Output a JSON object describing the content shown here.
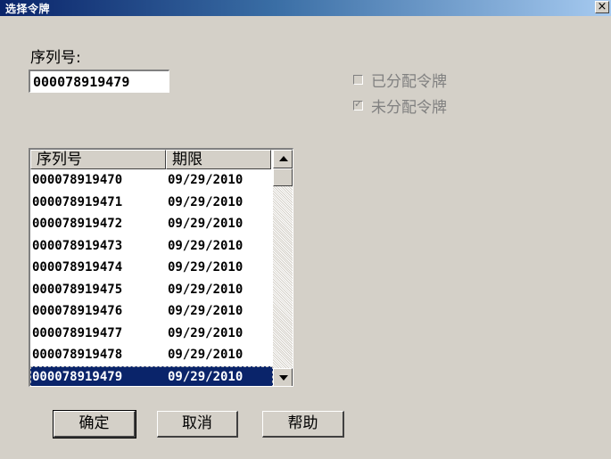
{
  "window": {
    "title": "选择令牌",
    "close_glyph": "×"
  },
  "serial": {
    "label": "序列号:",
    "value": "000078919479"
  },
  "checkboxes": [
    {
      "label": "已分配令牌",
      "checked": false
    },
    {
      "label": "未分配令牌",
      "checked": true
    }
  ],
  "list": {
    "columns": [
      "序列号",
      "期限"
    ],
    "rows": [
      [
        "000078919470",
        "09/29/2010"
      ],
      [
        "000078919471",
        "09/29/2010"
      ],
      [
        "000078919472",
        "09/29/2010"
      ],
      [
        "000078919473",
        "09/29/2010"
      ],
      [
        "000078919474",
        "09/29/2010"
      ],
      [
        "000078919475",
        "09/29/2010"
      ],
      [
        "000078919476",
        "09/29/2010"
      ],
      [
        "000078919477",
        "09/29/2010"
      ],
      [
        "000078919478",
        "09/29/2010"
      ],
      [
        "000078919479",
        "09/29/2010"
      ]
    ],
    "selected_row": 9
  },
  "buttons": {
    "ok": "确定",
    "cancel": "取消",
    "help": "帮助"
  },
  "colors": {
    "titlebar_start": "#0a246a",
    "selection": "#0a246a",
    "face": "#d4d0c8",
    "disabled_text": "#808080"
  }
}
